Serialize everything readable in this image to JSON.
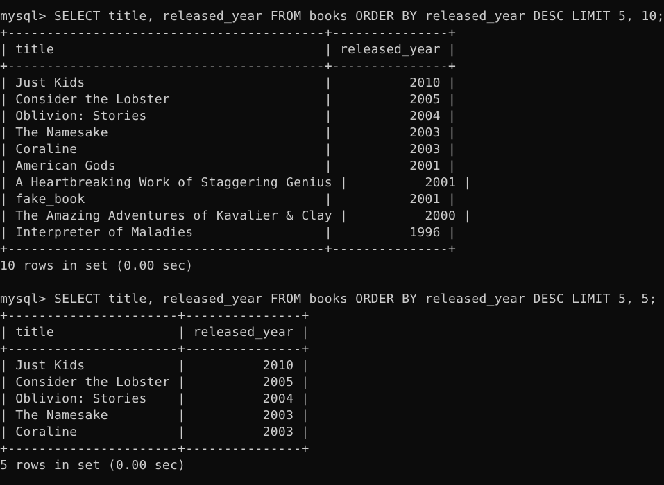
{
  "terminal": {
    "lines": [
      "mysql> SELECT title, released_year FROM books ORDER BY released_year DESC LIMIT 5, 10;",
      "+-----------------------------------------+---------------+",
      "| title                                   | released_year |",
      "+-----------------------------------------+---------------+",
      "| Just Kids                               |          2010 |",
      "| Consider the Lobster                    |          2005 |",
      "| Oblivion: Stories                       |          2004 |",
      "| The Namesake                            |          2003 |",
      "| Coraline                                |          2003 |",
      "| American Gods                           |          2001 |",
      "| A Heartbreaking Work of Staggering Genius |          2001 |",
      "| fake_book                               |          2001 |",
      "| The Amazing Adventures of Kavalier & Clay |          2000 |",
      "| Interpreter of Maladies                 |          1996 |",
      "+-----------------------------------------+---------------+",
      "10 rows in set (0.00 sec)",
      "",
      "mysql> SELECT title, released_year FROM books ORDER BY released_year DESC LIMIT 5, 5;",
      "+----------------------+---------------+",
      "| title                | released_year |",
      "+----------------------+---------------+",
      "| Just Kids            |          2010 |",
      "| Consider the Lobster |          2005 |",
      "| Oblivion: Stories    |          2004 |",
      "| The Namesake         |          2003 |",
      "| Coraline             |          2003 |",
      "+----------------------+---------------+",
      "5 rows in set (0.00 sec)"
    ]
  }
}
